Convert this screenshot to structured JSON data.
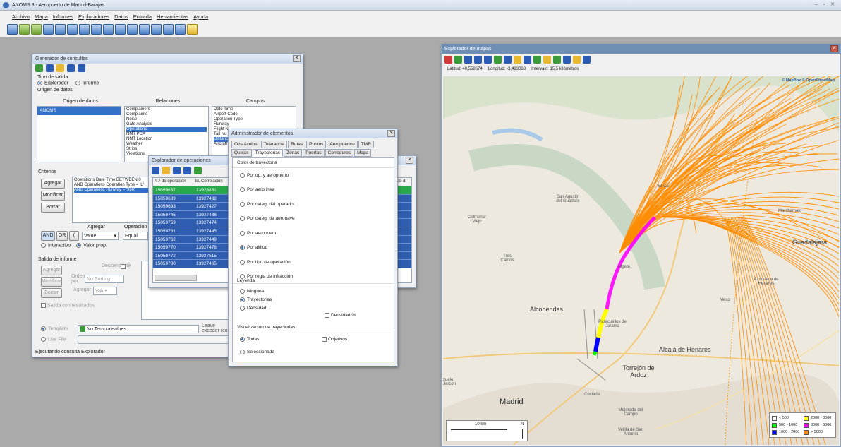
{
  "app": {
    "title": "ANOMS 8 - Aeropuerto de Madrid-Barajas",
    "menu": [
      "Archivo",
      "Mapa",
      "Informes",
      "Exploradores",
      "Datos",
      "Entrada",
      "Herramientas",
      "Ayuda"
    ]
  },
  "query": {
    "title": "Generador de consultas",
    "output_type_label": "Tipo de salida",
    "opt_explorer": "Explorador",
    "opt_report": "Informe",
    "data_origin_label": "Origen de datos",
    "col_origin": "Origen de datos",
    "col_relations": "Relaciones",
    "col_fields": "Campos",
    "origins": [
      "ANOMS"
    ],
    "relations": [
      "Complainers",
      "Complaints",
      "Noise",
      "Gate Analysis",
      "Operations",
      "NMT PCA",
      "NMT Location",
      "Weather",
      "Strips",
      "Violations"
    ],
    "fields": [
      "Date Time",
      "Airport Code",
      "Operation Type",
      "Runway",
      "Flight N",
      "Tail Nu",
      "Distanc",
      "Aircraft"
    ],
    "criteria_label": "Criterios",
    "criteria": [
      "Operations Date Time BETWEEN 0",
      "AND Operations Operation Type = 'L'",
      "AND Operations Runway = '36R'"
    ],
    "btn_add": "Agregar",
    "btn_modify": "Modificar",
    "btn_delete": "Borrar",
    "group_label": "Agregar",
    "op_label": "Operación",
    "value": "Value",
    "equal": "Equal",
    "and": "AND",
    "or": "OR",
    "interactive": "Interactivo",
    "value_prop": "Valor prop.",
    "report_output_label": "Salida de informe",
    "desc": "Descendente",
    "order_by": "Orden por",
    "no_sorting": "No Sorting",
    "btn_add2": "Agregar",
    "btn_modify2": "Modificar",
    "btn_delete2": "Borrar",
    "group_value": "Value",
    "with_results": "Salida con resultados",
    "template_label": "Template",
    "template_value": "No Templatealues",
    "use_file": "Use File",
    "leave_label": "Leave",
    "exceed_label": "exceder (co",
    "status": "Ejecutando consulta Explorador"
  },
  "ops": {
    "title": "Explorador de operaciones",
    "col_op": "N.º de operación",
    "col_corr": "Id. Correlación",
    "col_extra": "Ide d.",
    "rows": [
      [
        "15059637",
        "13926831"
      ],
      [
        "15059689",
        "13927432"
      ],
      [
        "15059693",
        "13927427"
      ],
      [
        "15059745",
        "13927438"
      ],
      [
        "15059759",
        "13927474"
      ],
      [
        "15059761",
        "13927445"
      ],
      [
        "15059762",
        "13927449"
      ],
      [
        "15059770",
        "13927476"
      ],
      [
        "15059772",
        "13927515"
      ],
      [
        "15059780",
        "13927465"
      ]
    ]
  },
  "elements": {
    "title": "Administrador de elementos",
    "tabs_row1": [
      "Obstáculos",
      "Tolerancia",
      "Rutas",
      "Puntos",
      "Aeropuertos",
      "TMR"
    ],
    "tabs_row2": [
      "Quejas",
      "Trayectorias",
      "Zonas",
      "Puertas",
      "Corredores",
      "Mapa"
    ],
    "color_label": "Color de trayectoria",
    "color_opts": [
      "Por op. y aeropuerto",
      "Por aerolínea",
      "Por categ. del operador",
      "Por categ. de aeronave",
      "Por aeropuerto",
      "Por altitud",
      "Por tipo de operación",
      "Por regla de infracción"
    ],
    "color_selected": 5,
    "legend_label": "Leyenda",
    "legend_opts": [
      "Ninguna",
      "Trayectorias",
      "Densidad"
    ],
    "legend_selected": 1,
    "density_pct": "Densidad %",
    "vis_label": "Visualización de trayectorias",
    "vis_opts": [
      "Todas",
      "Seleccionada"
    ],
    "vis_selected": 0,
    "objectives": "Objetivos"
  },
  "map": {
    "title": "Explorador de mapas",
    "lat": "Latitud: 40,558674",
    "lon": "Longitud: -3,483068",
    "interval": "Intervalo: 15,5 kilómetros",
    "attribution": "© MapBox © OpenStreetMap",
    "scale": "10 km",
    "north": "N",
    "places": {
      "madrid": "Madrid",
      "alcobendas": "Alcobendas",
      "torrejon": "Torrejón de Ardoz",
      "alcala": "Alcalá de Henares",
      "guadalajara": "Guadalajara",
      "colmenar": "Colmenar Viejo",
      "tres_cantos": "Tres Cantos",
      "san_agustin": "San Agustín del Guadalix",
      "algete": "Algete",
      "paracuellos": "Paracuellos de Jarama",
      "coslada": "Coslada",
      "meco": "Meco",
      "mejorada": "Mejorada del Campo",
      "velilla": "Velilla de San Antonio",
      "el_casar": "El Ca",
      "azuqueca": "Azuqueca de Henares",
      "marchamalo": "Marchamalo",
      "jarcon": "zuelo Jarcón"
    },
    "legend": [
      {
        "label": "< 500",
        "color": "#ffffff"
      },
      {
        "label": "2000 - 3000",
        "color": "#ffff00"
      },
      {
        "label": "500 - 1000",
        "color": "#00ff00"
      },
      {
        "label": "3000 - 5000",
        "color": "#ff00ff"
      },
      {
        "label": "1000 - 2000",
        "color": "#0000ff"
      },
      {
        "label": "> 5000",
        "color": "#ff8c00"
      }
    ],
    "track_color": "#ff8c00"
  }
}
